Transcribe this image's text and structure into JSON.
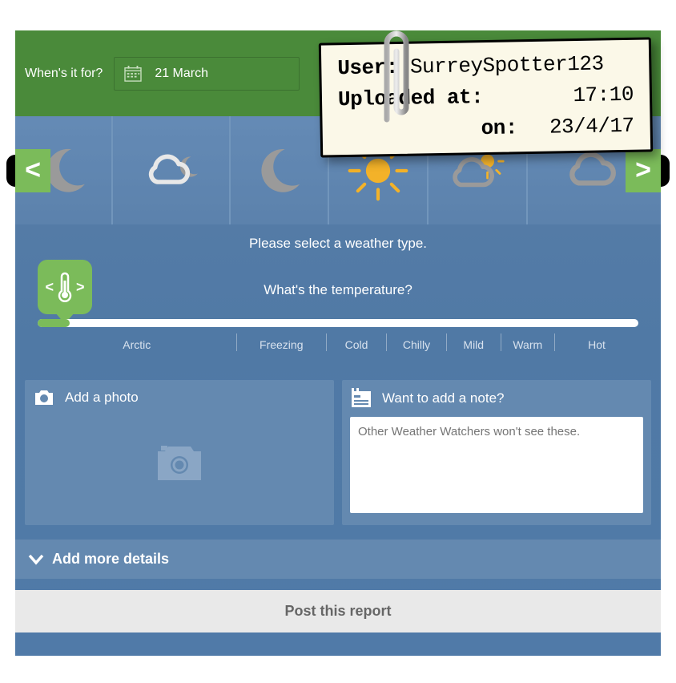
{
  "header": {
    "label": "When's it for?",
    "date": "21 March"
  },
  "weather": {
    "prompt": "Please select a weather type.",
    "nav_left": "<",
    "nav_right": ">"
  },
  "temperature": {
    "question": "What's the temperature?",
    "chevron_left": "<",
    "chevron_right": ">",
    "labels": [
      "Arctic",
      "Freezing",
      "Cold",
      "Chilly",
      "Mild",
      "Warm",
      "Hot"
    ]
  },
  "photo": {
    "title": "Add a photo"
  },
  "note": {
    "title": "Want to add a note?",
    "placeholder": "Other Weather Watchers won't see these."
  },
  "details": {
    "label": "Add more details"
  },
  "post": {
    "label": "Post this report"
  },
  "upload_note": {
    "user_label": "User:",
    "user_value": "SurreySpotter123",
    "uploaded_at_label": "Uploaded at:",
    "uploaded_at_value": "17:10",
    "on_label": "on:",
    "on_value": "23/4/17"
  }
}
